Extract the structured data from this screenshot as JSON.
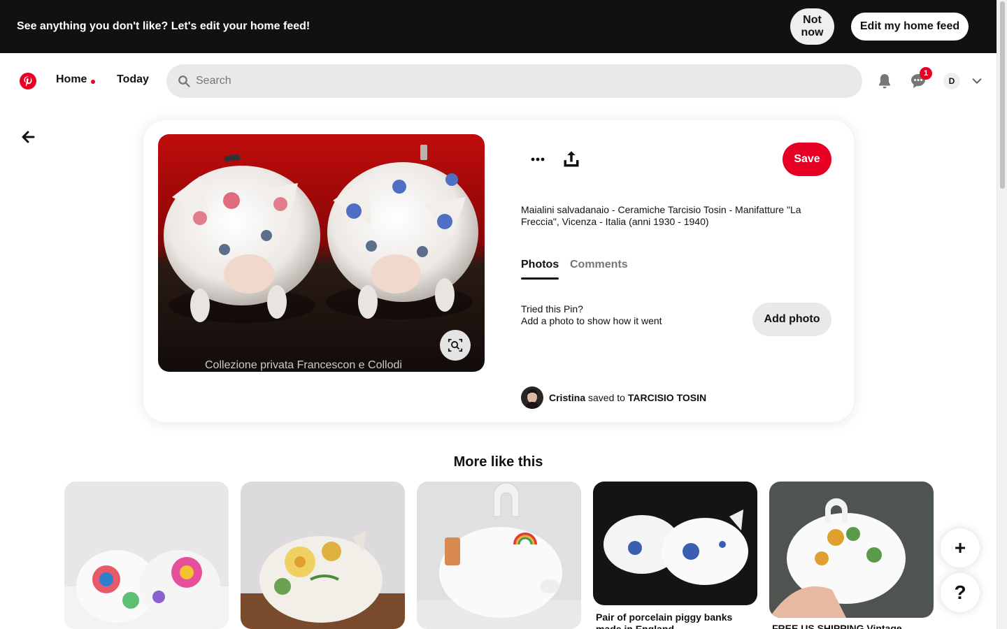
{
  "banner": {
    "message": "See anything you don't like? Let's edit your home feed!",
    "not_now_label": "Not now",
    "edit_label": "Edit my home feed"
  },
  "header": {
    "logo_icon": "pinterest-logo-icon",
    "home_label": "Home",
    "today_label": "Today",
    "search_placeholder": "Search",
    "notifications_icon": "bell-icon",
    "messages_icon": "chat-bubble-icon",
    "messages_badge": "1",
    "user_initial": "D",
    "account_menu_icon": "chevron-down-icon",
    "accent_color": "#e60023"
  },
  "pin": {
    "image_watermark": "Collezione privata Francescon e Collodi",
    "description": "Maialini salvadanaio - Ceramiche Tarcisio Tosin - Manifatture \"La Freccia\", Vicenza - Italia (anni 1930 - 1940)",
    "save_label": "Save",
    "tabs": [
      {
        "label": "Photos",
        "active": true
      },
      {
        "label": "Comments",
        "active": false
      }
    ],
    "tried_title": "Tried this Pin?",
    "tried_subtitle": "Add a photo to show how it went",
    "add_photo_label": "Add photo",
    "saver_name": "Cristina",
    "saved_to_text": "saved to",
    "board_name": "TARCISIO TOSIN"
  },
  "more": {
    "title": "More like this",
    "tiles": [
      {
        "caption": ""
      },
      {
        "caption": ""
      },
      {
        "caption": ""
      },
      {
        "caption": "Pair of porcelain piggy banks made in England"
      },
      {
        "caption": "FREE US SHIPPING Vintage"
      }
    ]
  },
  "fab": {
    "add_label": "+",
    "help_label": "?"
  }
}
